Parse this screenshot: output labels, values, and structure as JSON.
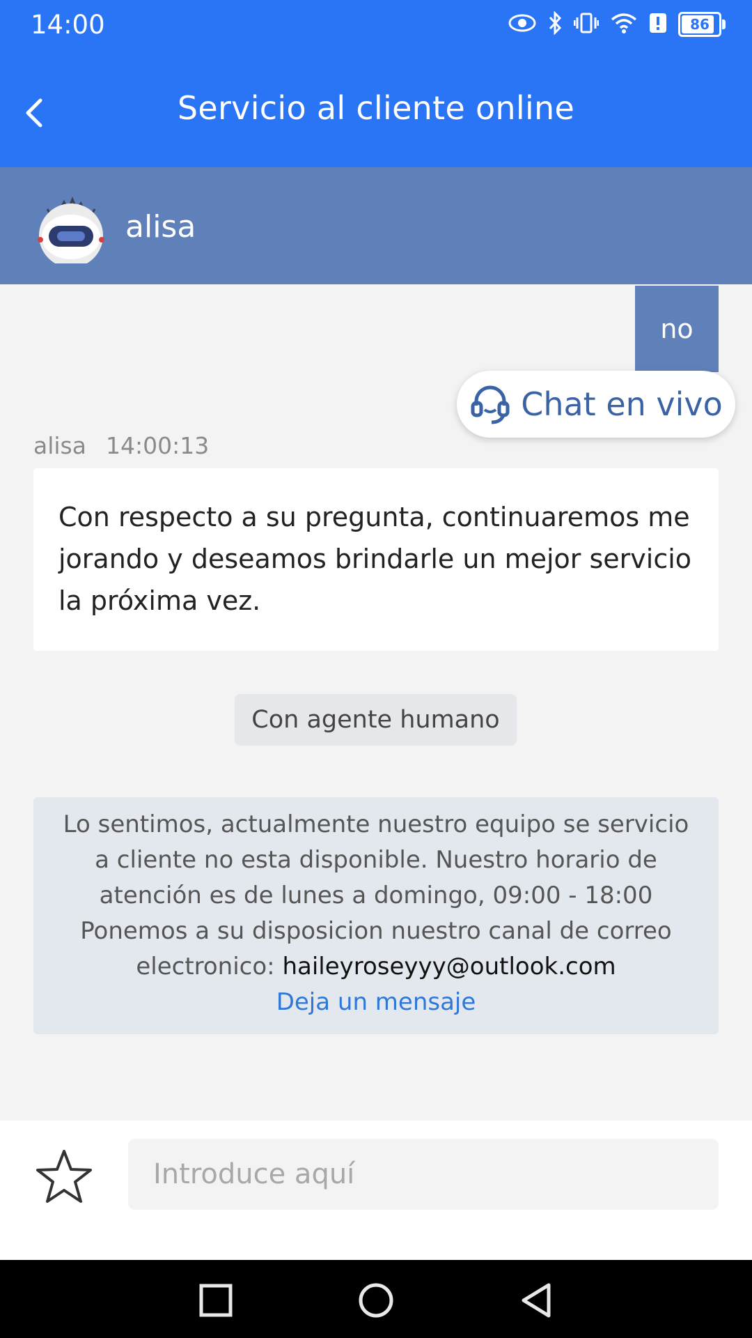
{
  "status_bar": {
    "time": "14:00",
    "battery": "86",
    "icons": [
      "eye-icon",
      "bluetooth-icon",
      "vibrate-icon",
      "wifi-icon",
      "alert-icon",
      "battery-icon"
    ]
  },
  "header": {
    "title": "Servicio al cliente online",
    "back_icon": "chevron-left-icon"
  },
  "agent": {
    "name": "alisa",
    "avatar_icon": "robot-avatar-icon"
  },
  "conversation": {
    "user_message": "no",
    "live_chat_label": "Chat en vivo",
    "bot_sender": "alisa",
    "bot_time": "14:00:13",
    "bot_message": "Con respecto a su pregunta, continuaremos me jorando y deseamos brindarle un mejor servicio  la próxima vez.",
    "human_agent_button": "Con agente humano",
    "notice": {
      "text_before": "Lo sentimos, actualmente nuestro equipo se servicio a cliente no esta disponible. Nuestro horario de atención es de lunes a domingo, 09:00 - 18:00 Ponemos a su disposicion nuestro canal de correo electronico:",
      "email": "haileyroseyyy@outlook.com",
      "leave_message_link": "Deja un mensaje"
    }
  },
  "input": {
    "placeholder": "Introduce aquí",
    "value": ""
  },
  "colors": {
    "primary": "#2a74f6",
    "agent_bar": "#5f80b9",
    "link": "#2e78d8"
  }
}
